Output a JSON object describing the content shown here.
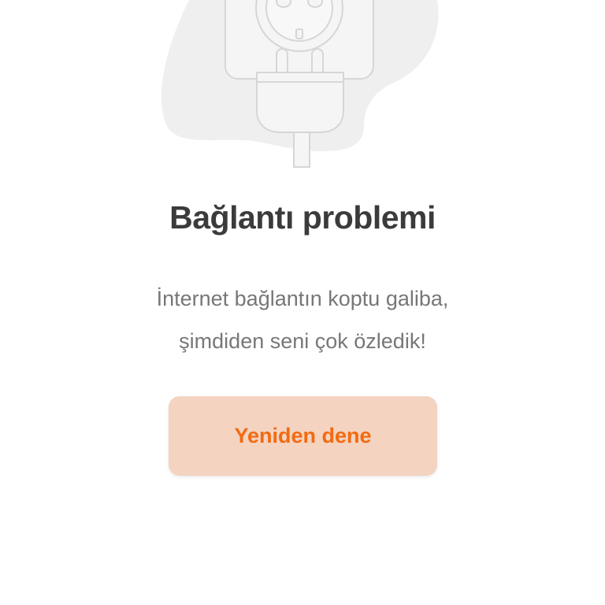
{
  "illustration": {
    "icon": "unplugged-socket-icon",
    "colors": {
      "blob": "#efefef",
      "surface": "#f5f5f5",
      "stroke": "#d6d6d6"
    }
  },
  "error": {
    "title": "Bağlantı problemi",
    "message_line_1": "İnternet bağlantın koptu galiba,",
    "message_line_2": "şimdiden seni çok özledik!"
  },
  "actions": {
    "retry_label": "Yeniden dene"
  },
  "colors": {
    "title": "#3b3b3b",
    "message": "#777777",
    "button_bg": "#f4d3c1",
    "button_text": "#f26b11"
  }
}
